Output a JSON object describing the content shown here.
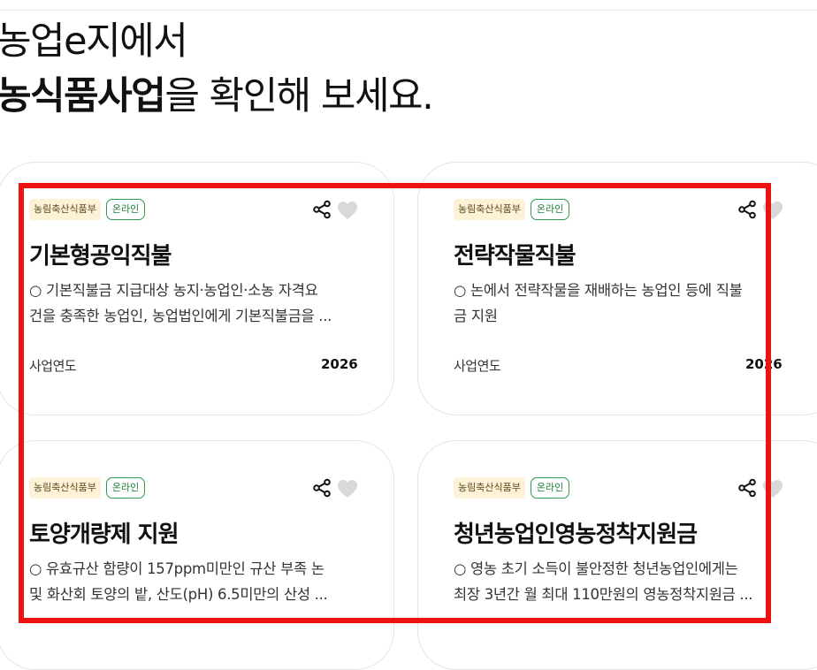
{
  "headline": {
    "line1": "농업e지에서",
    "line2_bold": "농식품사업",
    "line2_rest": "을 확인해 보세요."
  },
  "cards": [
    {
      "agency": "농림축산식품부",
      "channel": "온라인",
      "title": "기본형공익직불",
      "desc_line1": "○ 기본직불금 지급대상 농지·농업인·소농 자격요",
      "desc_line2": "건을 충족한 농업인, 농업법인에게 기본직불금을 ...",
      "year_label": "사업연도",
      "year": "2026"
    },
    {
      "agency": "농림축산식품부",
      "channel": "온라인",
      "title": "전략작물직불",
      "desc_line1": "○ 논에서 전략작물을 재배하는 농업인 등에 직불",
      "desc_line2": "금 지원",
      "year_label": "사업연도",
      "year": "2026"
    },
    {
      "agency": "농림축산식품부",
      "channel": "온라인",
      "title": "토양개량제 지원",
      "desc_line1": "○ 유효규산 함량이 157ppm미만인 규산 부족 논",
      "desc_line2": "및 화산회 토양의 밭, 산도(pH) 6.5미만의 산성 ..."
    },
    {
      "agency": "농림축산식품부",
      "channel": "온라인",
      "title": "청년농업인영농정착지원금",
      "desc_line1": "○ 영농 초기 소득이 불안정한 청년농업인에게는",
      "desc_line2": "최장 3년간 월 최대 110만원의 영농정착지원금 ..."
    }
  ],
  "icons": {
    "share": "share-icon",
    "heart": "heart-icon"
  },
  "colors": {
    "highlight": "#ee1111",
    "agency_tag_bg": "#fdf1d7",
    "online_tag_border": "#2f9a4d",
    "heart": "#d9d9d9"
  }
}
